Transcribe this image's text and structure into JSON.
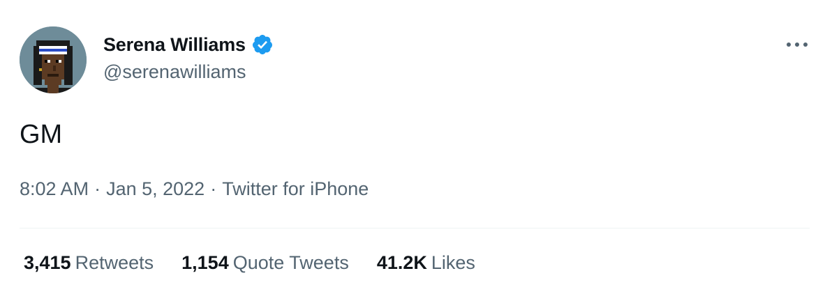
{
  "author": {
    "display_name": "Serena Williams",
    "handle": "@serenawilliams",
    "verified": true,
    "verified_color": "#1d9bf0"
  },
  "tweet": {
    "text": "GM"
  },
  "meta": {
    "time": "8:02 AM",
    "date": "Jan 5, 2022",
    "separator": "·",
    "source": "Twitter for iPhone"
  },
  "stats": [
    {
      "count": "3,415",
      "label": "Retweets"
    },
    {
      "count": "1,154",
      "label": "Quote Tweets"
    },
    {
      "count": "41.2K",
      "label": "Likes"
    }
  ],
  "icons": {
    "more": "more-horizontal-icon",
    "verified": "verified-badge-icon"
  },
  "colors": {
    "text_primary": "#0f1419",
    "text_secondary": "#536471",
    "divider": "#eff3f4",
    "avatar_bg": "#6e8c99"
  }
}
